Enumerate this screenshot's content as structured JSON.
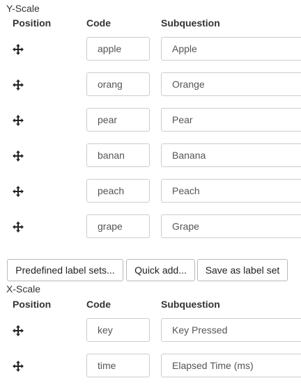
{
  "y_scale": {
    "title": "Y-Scale",
    "headers": {
      "position": "Position",
      "code": "Code",
      "subquestion": "Subquestion"
    },
    "rows": [
      {
        "code": "apple",
        "subquestion": "Apple"
      },
      {
        "code": "orang",
        "subquestion": "Orange"
      },
      {
        "code": "pear",
        "subquestion": "Pear"
      },
      {
        "code": "banan",
        "subquestion": "Banana"
      },
      {
        "code": "peach",
        "subquestion": "Peach"
      },
      {
        "code": "grape",
        "subquestion": "Grape"
      }
    ]
  },
  "buttons": {
    "predefined": "Predefined label sets...",
    "quick_add": "Quick add...",
    "save_label_set": "Save as label set"
  },
  "x_scale": {
    "title": "X-Scale",
    "headers": {
      "position": "Position",
      "code": "Code",
      "subquestion": "Subquestion"
    },
    "rows": [
      {
        "code": "key",
        "subquestion": "Key Pressed"
      },
      {
        "code": "time",
        "subquestion": "Elapsed Time (ms)"
      }
    ]
  },
  "icons": {
    "move": "move-arrows-icon"
  },
  "colors": {
    "border": "#cccccc",
    "text": "#333333",
    "input_text": "#555555",
    "icon": "#222222"
  }
}
